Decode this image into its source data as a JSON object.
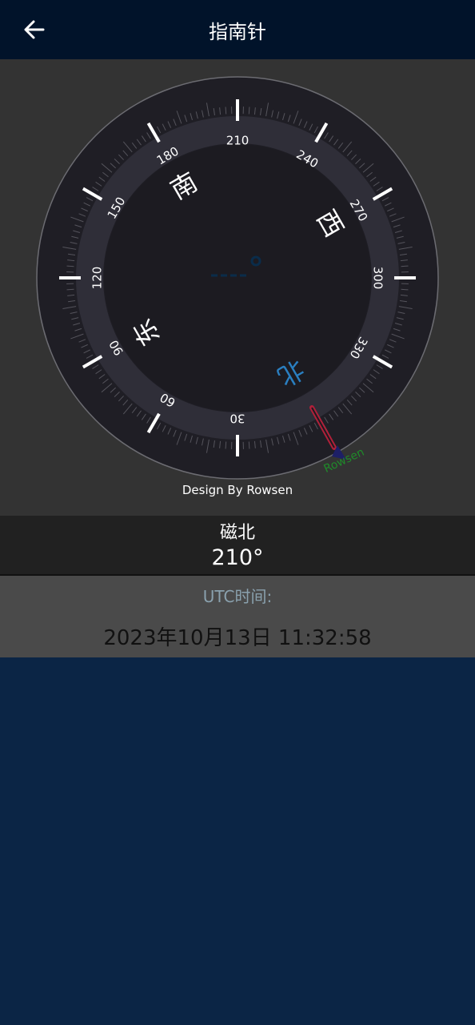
{
  "header": {
    "title": "指南针",
    "back_icon": "arrow-left-icon"
  },
  "compass": {
    "degree_labels": [
      "210",
      "240",
      "270",
      "300",
      "330",
      "30",
      "60",
      "90",
      "120",
      "150",
      "180"
    ],
    "cardinals": {
      "south": "南",
      "west": "西",
      "north": "北",
      "east": "东"
    },
    "watermark": "Rowsen",
    "credit": "Design By Rowsen",
    "colors": {
      "north": "#2a7fc1",
      "watermark": "#1f8a2a",
      "needle": "#c0233a"
    }
  },
  "heading": {
    "label": "磁北",
    "value": "210°"
  },
  "utc": {
    "label": "UTC时间:",
    "value": "2023年10月13日 11:32:58"
  }
}
